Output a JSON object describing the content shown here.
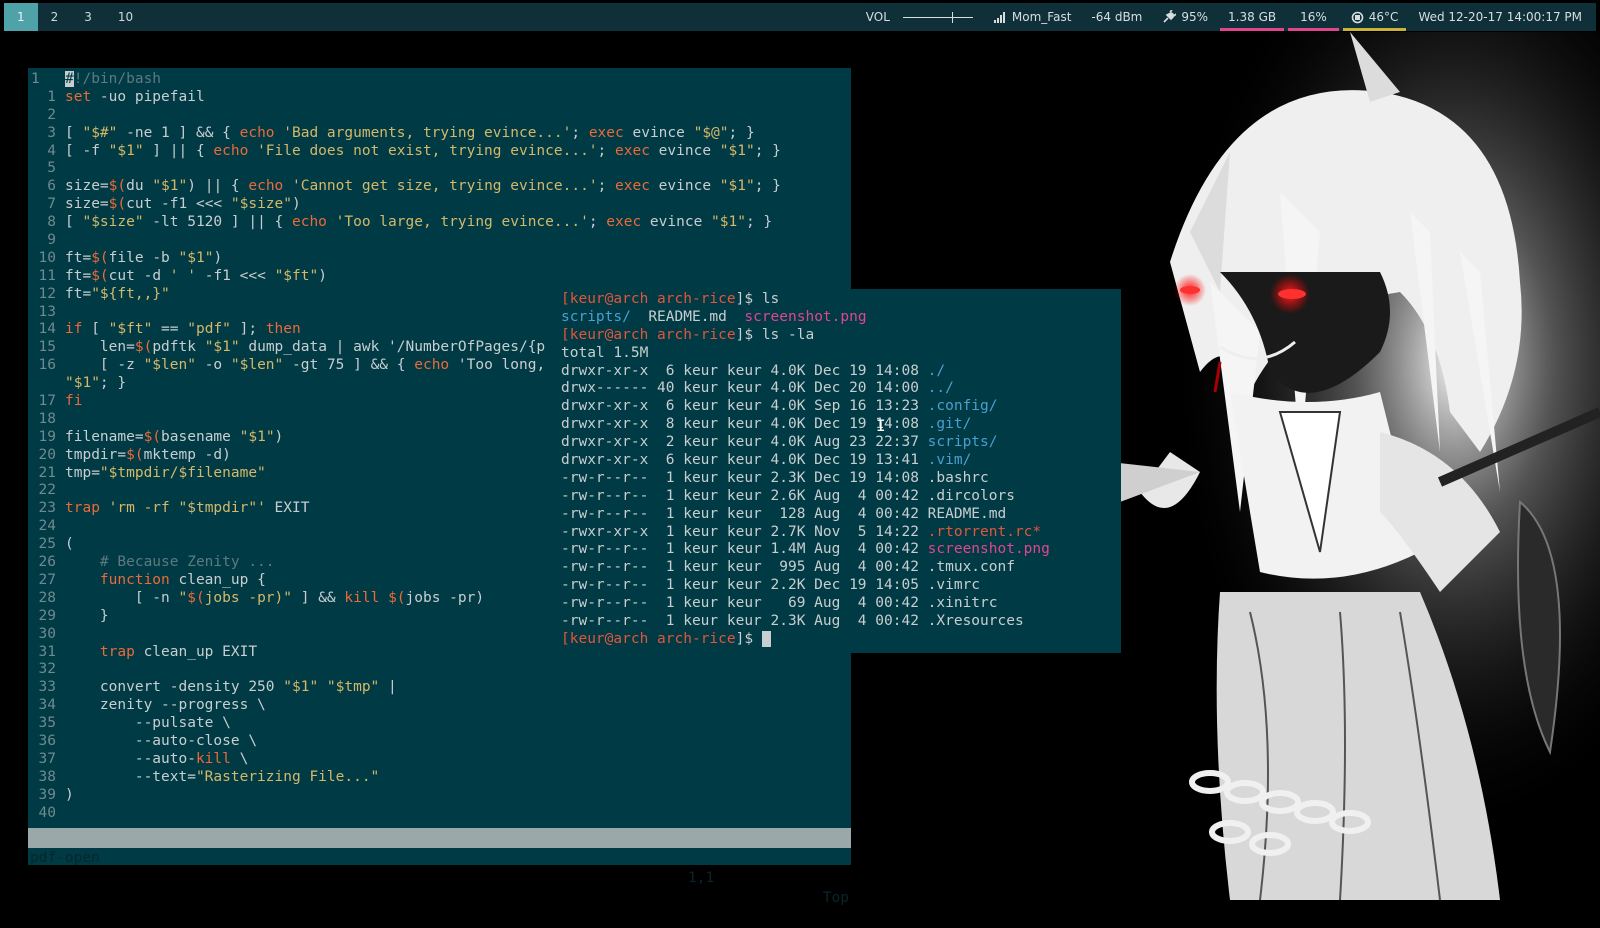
{
  "topbar": {
    "workspaces": [
      "1",
      "2",
      "3",
      "10"
    ],
    "active_workspace": "1",
    "volume_label": "VOL",
    "volume_level": 0.7,
    "wifi_name": "Mom_Fast",
    "signal": "-64 dBm",
    "battery": "95%",
    "memory": "1.38 GB",
    "cpu": "16%",
    "temp": "46°C",
    "datetime": "Wed 12-20-17 14:00:17 PM",
    "colors": {
      "bar_bg": "#0f3038",
      "active_ws": "#4fa3a8",
      "memory_underline": "#e0468e",
      "cpu_underline": "#e0468e",
      "temp_underline": "#c8b43a"
    }
  },
  "vim": {
    "first_line_number": "1",
    "lines": [
      {
        "n": "1",
        "code": "set -uo pipefail"
      },
      {
        "n": "2",
        "code": ""
      },
      {
        "n": "3",
        "code": "[ \"$#\" -ne 1 ] && { echo 'Bad arguments, trying evince...'; exec evince \"$@\"; }"
      },
      {
        "n": "4",
        "code": "[ -f \"$1\" ] || { echo 'File does not exist, trying evince...'; exec evince \"$1\"; }"
      },
      {
        "n": "5",
        "code": ""
      },
      {
        "n": "6",
        "code": "size=$(du \"$1\") || { echo 'Cannot get size, trying evince...'; exec evince \"$1\"; }"
      },
      {
        "n": "7",
        "code": "size=$(cut -f1 <<< \"$size\")"
      },
      {
        "n": "8",
        "code": "[ \"$size\" -lt 5120 ] || { echo 'Too large, trying evince...'; exec evince \"$1\"; }"
      },
      {
        "n": "9",
        "code": ""
      },
      {
        "n": "10",
        "code": "ft=$(file -b \"$1\")"
      },
      {
        "n": "11",
        "code": "ft=$(cut -d ' ' -f1 <<< \"$ft\")"
      },
      {
        "n": "12",
        "code": "ft=\"${ft,,}\""
      },
      {
        "n": "13",
        "code": ""
      },
      {
        "n": "14",
        "code": "if [ \"$ft\" == \"pdf\" ]; then"
      },
      {
        "n": "15",
        "code": "    len=$(pdftk \"$1\" dump_data | awk '/NumberOfPages/{p"
      },
      {
        "n": "16",
        "code": "    [ -z \"$len\" -o \"$len\" -gt 75 ] && { echo 'Too long,"
      },
      {
        "n": "",
        "code": "\"$1\"; }"
      },
      {
        "n": "17",
        "code": "fi"
      },
      {
        "n": "18",
        "code": ""
      },
      {
        "n": "19",
        "code": "filename=$(basename \"$1\")"
      },
      {
        "n": "20",
        "code": "tmpdir=$(mktemp -d)"
      },
      {
        "n": "21",
        "code": "tmp=\"$tmpdir/$filename\""
      },
      {
        "n": "22",
        "code": ""
      },
      {
        "n": "23",
        "code": "trap 'rm -rf \"$tmpdir\"' EXIT"
      },
      {
        "n": "24",
        "code": ""
      },
      {
        "n": "25",
        "code": "("
      },
      {
        "n": "26",
        "code": "    # Because Zenity ..."
      },
      {
        "n": "27",
        "code": "    function clean_up {"
      },
      {
        "n": "28",
        "code": "        [ -n \"$(jobs -pr)\" ] && kill $(jobs -pr)"
      },
      {
        "n": "29",
        "code": "    }"
      },
      {
        "n": "30",
        "code": ""
      },
      {
        "n": "31",
        "code": "    trap clean_up EXIT"
      },
      {
        "n": "32",
        "code": ""
      },
      {
        "n": "33",
        "code": "    convert -density 250 \"$1\" \"$tmp\" |"
      },
      {
        "n": "34",
        "code": "    zenity --progress \\"
      },
      {
        "n": "35",
        "code": "        --pulsate \\"
      },
      {
        "n": "36",
        "code": "        --auto-close \\"
      },
      {
        "n": "37",
        "code": "        --auto-kill \\"
      },
      {
        "n": "38",
        "code": "        --text=\"Rasterizing File...\""
      },
      {
        "n": "39",
        "code": ")"
      },
      {
        "n": "40",
        "code": ""
      }
    ],
    "first_line_cursor_char": "#",
    "first_line_rest": "!/bin/bash",
    "status": {
      "filename": "pdf-open",
      "position": "1,1",
      "percent": "Top"
    }
  },
  "terminal": {
    "prompt_user": "[keur@arch",
    "prompt_dir": "arch-rice",
    "prompt_end": "]$",
    "cmd1": "ls",
    "ls_short": [
      {
        "name": "scripts/",
        "kind": "dir"
      },
      {
        "name": "README.md",
        "kind": "file"
      },
      {
        "name": "screenshot.png",
        "kind": "image"
      }
    ],
    "cmd2": "ls -la",
    "total": "total 1.5M",
    "entries": [
      {
        "perm": "drwxr-xr-x",
        "links": " 6",
        "user": "keur",
        "group": "keur",
        "size": "4.0K",
        "date": "Dec 19 14:08",
        "name": "./",
        "kind": "dir"
      },
      {
        "perm": "drwx------",
        "links": "40",
        "user": "keur",
        "group": "keur",
        "size": "4.0K",
        "date": "Dec 20 14:00",
        "name": "../",
        "kind": "dir"
      },
      {
        "perm": "drwxr-xr-x",
        "links": " 6",
        "user": "keur",
        "group": "keur",
        "size": "4.0K",
        "date": "Sep 16 13:23",
        "name": ".config/",
        "kind": "dir"
      },
      {
        "perm": "drwxr-xr-x",
        "links": " 8",
        "user": "keur",
        "group": "keur",
        "size": "4.0K",
        "date": "Dec 19 14:08",
        "name": ".git/",
        "kind": "dir"
      },
      {
        "perm": "drwxr-xr-x",
        "links": " 2",
        "user": "keur",
        "group": "keur",
        "size": "4.0K",
        "date": "Aug 23 22:37",
        "name": "scripts/",
        "kind": "dir"
      },
      {
        "perm": "drwxr-xr-x",
        "links": " 6",
        "user": "keur",
        "group": "keur",
        "size": "4.0K",
        "date": "Dec 19 13:41",
        "name": ".vim/",
        "kind": "dir"
      },
      {
        "perm": "-rw-r--r--",
        "links": " 1",
        "user": "keur",
        "group": "keur",
        "size": "2.3K",
        "date": "Dec 19 14:08",
        "name": ".bashrc",
        "kind": "file"
      },
      {
        "perm": "-rw-r--r--",
        "links": " 1",
        "user": "keur",
        "group": "keur",
        "size": "2.6K",
        "date": "Aug  4 00:42",
        "name": ".dircolors",
        "kind": "file"
      },
      {
        "perm": "-rw-r--r--",
        "links": " 1",
        "user": "keur",
        "group": "keur",
        "size": " 128",
        "date": "Aug  4 00:42",
        "name": "README.md",
        "kind": "file"
      },
      {
        "perm": "-rwxr-xr-x",
        "links": " 1",
        "user": "keur",
        "group": "keur",
        "size": "2.7K",
        "date": "Nov  5 14:22",
        "name": ".rtorrent.rc*",
        "kind": "exec"
      },
      {
        "perm": "-rw-r--r--",
        "links": " 1",
        "user": "keur",
        "group": "keur",
        "size": "1.4M",
        "date": "Aug  4 00:42",
        "name": "screenshot.png",
        "kind": "image"
      },
      {
        "perm": "-rw-r--r--",
        "links": " 1",
        "user": "keur",
        "group": "keur",
        "size": " 995",
        "date": "Aug  4 00:42",
        "name": ".tmux.conf",
        "kind": "file"
      },
      {
        "perm": "-rw-r--r--",
        "links": " 1",
        "user": "keur",
        "group": "keur",
        "size": "2.2K",
        "date": "Dec 19 14:05",
        "name": ".vimrc",
        "kind": "file"
      },
      {
        "perm": "-rw-r--r--",
        "links": " 1",
        "user": "keur",
        "group": "keur",
        "size": "  69",
        "date": "Aug  4 00:42",
        "name": ".xinitrc",
        "kind": "file"
      },
      {
        "perm": "-rw-r--r--",
        "links": " 1",
        "user": "keur",
        "group": "keur",
        "size": "2.3K",
        "date": "Aug  4 00:42",
        "name": ".Xresources",
        "kind": "file"
      }
    ]
  }
}
